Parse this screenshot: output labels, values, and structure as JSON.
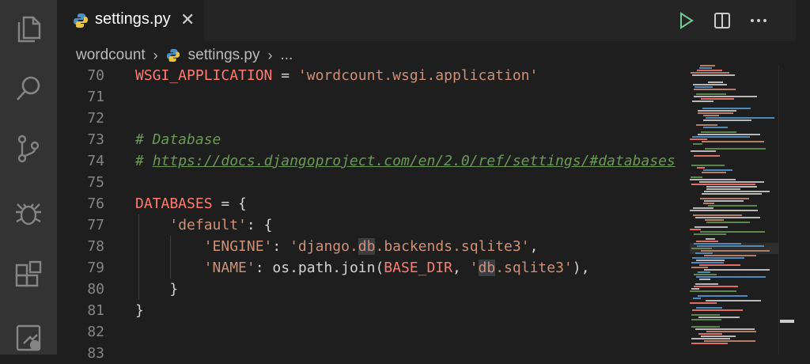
{
  "tab": {
    "title": "settings.py",
    "close_glyph": "✕"
  },
  "breadcrumb": {
    "folder": "wordcount",
    "file": "settings.py",
    "more": "..."
  },
  "lines": [
    {
      "num": "70"
    },
    {
      "num": "71"
    },
    {
      "num": "72"
    },
    {
      "num": "73"
    },
    {
      "num": "74"
    },
    {
      "num": "75"
    },
    {
      "num": "76"
    },
    {
      "num": "77"
    },
    {
      "num": "78"
    },
    {
      "num": "79"
    },
    {
      "num": "80"
    },
    {
      "num": "81"
    },
    {
      "num": "82"
    },
    {
      "num": "83"
    }
  ],
  "code": {
    "l70_name": "WSGI_APPLICATION",
    "l70_eq": " = ",
    "l70_value": "'wordcount.wsgi.application'",
    "l73_comment": "# Database",
    "l74_hash": "# ",
    "l74_url": "https://docs.djangoproject.com/en/2.0/ref/settings/#databases",
    "l76_name": "DATABASES",
    "l76_rest": " = {",
    "l77_key": "'default'",
    "l77_rest": ": {",
    "l78_key": "'ENGINE'",
    "l78_colon": ": ",
    "l78_v1": "'django.",
    "l78_v2": "db",
    "l78_v3": ".backends.sqlite3'",
    "l78_end": ",",
    "l79_key": "'NAME'",
    "l79_mid": ": os.path.join(",
    "l79_base": "BASE_DIR",
    "l79_comma": ", ",
    "l79_q": "'",
    "l79_db": "db",
    "l79_rest": ".sqlite3'",
    "l79_end": "),",
    "l80": "}",
    "l81": "}"
  },
  "colors": {
    "string": "#ce9178",
    "comment": "#6a9955",
    "constant": "#ff7b72",
    "run_icon": "#73c991"
  },
  "icons": [
    "files-icon",
    "search-icon",
    "source-control-icon",
    "debug-icon",
    "extensions-icon",
    "remote-icon",
    "python-icon",
    "run-icon",
    "split-editor-icon",
    "more-actions-icon"
  ]
}
